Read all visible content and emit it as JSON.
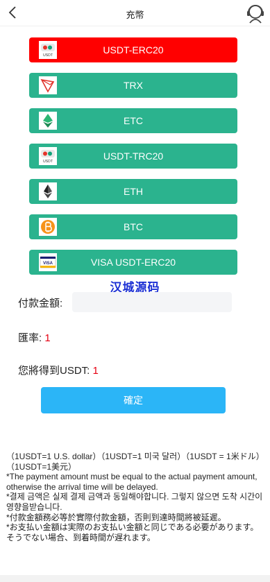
{
  "header": {
    "title": "充幣"
  },
  "payments": [
    {
      "label": "USDT-ERC20",
      "icon": "usdt-icon",
      "active": true
    },
    {
      "label": "TRX",
      "icon": "trx-icon",
      "active": false
    },
    {
      "label": "ETC",
      "icon": "etc-icon",
      "active": false
    },
    {
      "label": "USDT-TRC20",
      "icon": "usdt-icon",
      "active": false
    },
    {
      "label": "ETH",
      "icon": "eth-icon",
      "active": false
    },
    {
      "label": "BTC",
      "icon": "btc-icon",
      "active": false
    },
    {
      "label": "VISA USDT-ERC20",
      "icon": "visa-icon",
      "active": false
    }
  ],
  "icon_text": {
    "usdt": "USDT",
    "visa": "VISA"
  },
  "watermark": "汉城源码",
  "form": {
    "amount_label": "付款金額:",
    "amount_value": "",
    "rate_label": "匯率:",
    "rate_value": "1",
    "receive_label": "您將得到USDT:",
    "receive_value": "1"
  },
  "confirm_label": "確定",
  "notes": [
    "（1USDT=1 U.S. dollar）（1USDT=1 미국 달러）（1USDT = 1米ドル）（1USDT=1美元）",
    "*The payment amount must be equal to the actual payment amount, otherwise the arrival time will be delayed.",
    "*결제 금액은 실제 결제 금액과 동일해야합니다. 그렇지 않으면 도착 시간이 영향을받습니다.",
    "*付款金額務必等於實際付款金額，否則到達時間將被延遲。",
    "*お支払い金額は実際のお支払い金額と同じである必要があります。そうでない場合、到着時間が遅れます。"
  ],
  "colors": {
    "active": "#ff0000",
    "green": "#2bb38e",
    "confirm": "#2bb5f7",
    "accent_red": "#e60012"
  }
}
